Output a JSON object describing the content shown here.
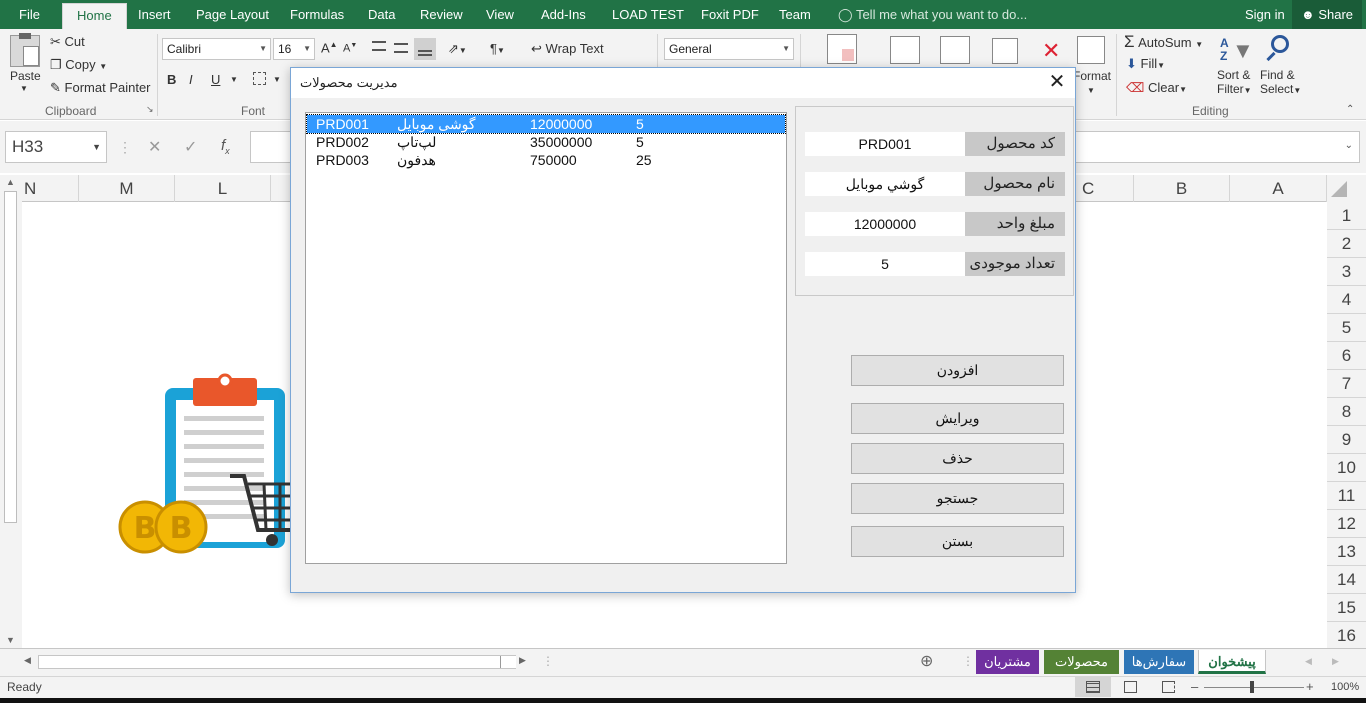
{
  "ribbon_tabs": [
    "File",
    "Home",
    "Insert",
    "Page Layout",
    "Formulas",
    "Data",
    "Review",
    "View",
    "Add-Ins",
    "LOAD TEST",
    "Foxit PDF",
    "Team"
  ],
  "active_tab": "Home",
  "tell_me": "Tell me what you want to do...",
  "sign_in": "Sign in",
  "share": "Share",
  "clipboard": {
    "paste": "Paste",
    "cut": "Cut",
    "copy": "Copy",
    "format_painter": "Format Painter",
    "group": "Clipboard"
  },
  "font": {
    "family": "Calibri",
    "size": "16",
    "group": "Font",
    "bold": "B",
    "italic": "I",
    "underline": "U"
  },
  "alignment": {
    "wrap_text": "Wrap Text"
  },
  "number": {
    "format": "General"
  },
  "cells": {
    "format": "Format"
  },
  "editing": {
    "autosum": "AutoSum",
    "fill": "Fill",
    "clear": "Clear",
    "sort_filter_1": "Sort &",
    "sort_filter_2": "Filter",
    "find_select_1": "Find &",
    "find_select_2": "Select",
    "group": "Editing"
  },
  "name_box": "H33",
  "columns": [
    "N",
    "M",
    "L",
    "C",
    "B",
    "A"
  ],
  "rows": [
    "1",
    "2",
    "3",
    "4",
    "5",
    "6",
    "7",
    "8",
    "9",
    "10",
    "11",
    "12",
    "13",
    "14",
    "15",
    "16"
  ],
  "sheet_tabs": [
    {
      "label": "پیشخوان",
      "color": "#ffffff",
      "text": "#217346"
    },
    {
      "label": "سفارش‌ها",
      "color": "#2e75b6",
      "text": "#ffffff"
    },
    {
      "label": "محصولات",
      "color": "#548235",
      "text": "#ffffff"
    },
    {
      "label": "مشتریان",
      "color": "#7030a0",
      "text": "#ffffff"
    }
  ],
  "status": {
    "ready": "Ready",
    "zoom": "100%"
  },
  "dialog": {
    "title": "مدیریت محصولات",
    "list": [
      {
        "code": "PRD001",
        "name": "گوشی موبایل",
        "price": "12000000",
        "qty": "5"
      },
      {
        "code": "PRD002",
        "name": "لپ‌تاپ",
        "price": "35000000",
        "qty": "5"
      },
      {
        "code": "PRD003",
        "name": "هدفون",
        "price": "750000",
        "qty": "25"
      }
    ],
    "fields": [
      {
        "label": "کد محصول",
        "value": "PRD001"
      },
      {
        "label": "نام محصول",
        "value": "گوشي موبایل"
      },
      {
        "label": "مبلغ واحد",
        "value": "12000000"
      },
      {
        "label": "تعداد موجودی",
        "value": "5"
      }
    ],
    "buttons": {
      "add": "افزودن",
      "edit": "ویرایش",
      "delete": "حذف",
      "search": "جستجو",
      "close": "بستن"
    }
  }
}
